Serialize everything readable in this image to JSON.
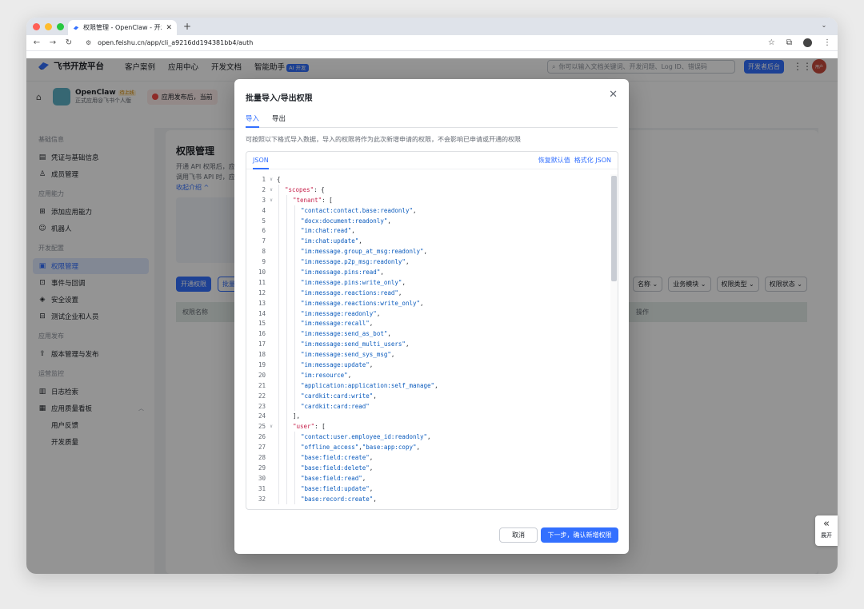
{
  "browser": {
    "tab_title": "权限管理 - OpenClaw - 开发者",
    "url": "open.feishu.cn/app/cli_a9216dd194381bb4/auth",
    "colors": {
      "close": "#ff5f57",
      "minimize": "#febc2e",
      "maximize": "#28c840"
    }
  },
  "header": {
    "brand": "飞书开放平台",
    "nav": [
      "客户案例",
      "应用中心",
      "开发文档",
      "智能助手"
    ],
    "ai_badge": "AI 开发",
    "search_placeholder": "你可以输入文档关键词、开发问题、Log ID、错误码",
    "dev_console": "开发者后台",
    "user_initials": "用户"
  },
  "app": {
    "name": "OpenClaw",
    "status": "待上线",
    "subtitle": "正式应用@飞书个人版",
    "notice": "应用发布后，当前"
  },
  "sidebar": {
    "groups": [
      {
        "title": "基础信息",
        "items": [
          {
            "icon": "doc-icon",
            "label": "凭证与基础信息"
          },
          {
            "icon": "person-icon",
            "label": "成员管理"
          }
        ]
      },
      {
        "title": "应用能力",
        "items": [
          {
            "icon": "grid-plus-icon",
            "label": "添加应用能力"
          },
          {
            "icon": "robot-icon",
            "label": "机器人"
          }
        ]
      },
      {
        "title": "开发配置",
        "items": [
          {
            "icon": "lock-icon",
            "label": "权限管理",
            "active": true
          },
          {
            "icon": "event-icon",
            "label": "事件与回调"
          },
          {
            "icon": "shield-icon",
            "label": "安全设置"
          },
          {
            "icon": "test-icon",
            "label": "测试企业和人员"
          }
        ]
      },
      {
        "title": "应用发布",
        "items": [
          {
            "icon": "upload-icon",
            "label": "版本管理与发布"
          }
        ]
      },
      {
        "title": "运营监控",
        "items": [
          {
            "icon": "log-icon",
            "label": "日志检索"
          },
          {
            "icon": "chart-icon",
            "label": "应用质量看板",
            "expanded": true
          },
          {
            "label": "用户反馈",
            "sub": true
          },
          {
            "label": "开发质量",
            "sub": true
          }
        ]
      }
    ]
  },
  "page": {
    "title": "权限管理",
    "desc_1": "开通 API 权限后，应",
    "desc_2": "调用飞书 API 时，应",
    "link": "收起介绍 ^",
    "btn_open": "开通权限",
    "btn_batch": "批量",
    "filters": [
      "名称",
      "业务模块",
      "权限类型",
      "权限状态"
    ],
    "col_name": "权限名称",
    "col_op": "操作"
  },
  "modal": {
    "title": "批量导入/导出权限",
    "tabs": [
      "导入",
      "导出"
    ],
    "description": "可按照以下格式导入数据，导入的权限将作为此次新增申请的权限，不会影响已申请或开通的权限",
    "editor_tab": "JSON",
    "restore": "恢复默认值",
    "format": "格式化 JSON",
    "cancel": "取消",
    "next": "下一步，确认新增权限",
    "code_lines": [
      {
        "n": "1",
        "fold": true,
        "indent": 0,
        "tokens": [
          [
            "pun",
            "{"
          ]
        ]
      },
      {
        "n": "2",
        "fold": true,
        "indent": 1,
        "tokens": [
          [
            "key",
            "\"scopes\""
          ],
          [
            "pun",
            ": {"
          ]
        ]
      },
      {
        "n": "3",
        "fold": true,
        "indent": 2,
        "tokens": [
          [
            "key",
            "\"tenant\""
          ],
          [
            "pun",
            ": ["
          ]
        ]
      },
      {
        "n": "4",
        "indent": 3,
        "tokens": [
          [
            "str",
            "\"contact:contact.base:readonly\""
          ],
          [
            "pun",
            ","
          ]
        ]
      },
      {
        "n": "5",
        "indent": 3,
        "tokens": [
          [
            "str",
            "\"docx:document:readonly\""
          ],
          [
            "pun",
            ","
          ]
        ]
      },
      {
        "n": "6",
        "indent": 3,
        "tokens": [
          [
            "str",
            "\"im:chat:read\""
          ],
          [
            "pun",
            ","
          ]
        ]
      },
      {
        "n": "7",
        "indent": 3,
        "tokens": [
          [
            "str",
            "\"im:chat:update\""
          ],
          [
            "pun",
            ","
          ]
        ]
      },
      {
        "n": "8",
        "indent": 3,
        "tokens": [
          [
            "str",
            "\"im:message.group_at_msg:readonly\""
          ],
          [
            "pun",
            ","
          ]
        ]
      },
      {
        "n": "9",
        "indent": 3,
        "tokens": [
          [
            "str",
            "\"im:message.p2p_msg:readonly\""
          ],
          [
            "pun",
            ","
          ]
        ]
      },
      {
        "n": "10",
        "indent": 3,
        "tokens": [
          [
            "str",
            "\"im:message.pins:read\""
          ],
          [
            "pun",
            ","
          ]
        ]
      },
      {
        "n": "11",
        "indent": 3,
        "tokens": [
          [
            "str",
            "\"im:message.pins:write_only\""
          ],
          [
            "pun",
            ","
          ]
        ]
      },
      {
        "n": "12",
        "indent": 3,
        "tokens": [
          [
            "str",
            "\"im:message.reactions:read\""
          ],
          [
            "pun",
            ","
          ]
        ]
      },
      {
        "n": "13",
        "indent": 3,
        "tokens": [
          [
            "str",
            "\"im:message.reactions:write_only\""
          ],
          [
            "pun",
            ","
          ]
        ]
      },
      {
        "n": "14",
        "indent": 3,
        "tokens": [
          [
            "str",
            "\"im:message:readonly\""
          ],
          [
            "pun",
            ","
          ]
        ]
      },
      {
        "n": "15",
        "indent": 3,
        "tokens": [
          [
            "str",
            "\"im:message:recall\""
          ],
          [
            "pun",
            ","
          ]
        ]
      },
      {
        "n": "16",
        "indent": 3,
        "tokens": [
          [
            "str",
            "\"im:message:send_as_bot\""
          ],
          [
            "pun",
            ","
          ]
        ]
      },
      {
        "n": "17",
        "indent": 3,
        "tokens": [
          [
            "str",
            "\"im:message:send_multi_users\""
          ],
          [
            "pun",
            ","
          ]
        ]
      },
      {
        "n": "18",
        "indent": 3,
        "tokens": [
          [
            "str",
            "\"im:message:send_sys_msg\""
          ],
          [
            "pun",
            ","
          ]
        ]
      },
      {
        "n": "19",
        "indent": 3,
        "tokens": [
          [
            "str",
            "\"im:message:update\""
          ],
          [
            "pun",
            ","
          ]
        ]
      },
      {
        "n": "20",
        "indent": 3,
        "tokens": [
          [
            "str",
            "\"im:resource\""
          ],
          [
            "pun",
            ","
          ]
        ]
      },
      {
        "n": "21",
        "indent": 3,
        "tokens": [
          [
            "str",
            "\"application:application:self_manage\""
          ],
          [
            "pun",
            ","
          ]
        ]
      },
      {
        "n": "22",
        "indent": 3,
        "tokens": [
          [
            "str",
            "\"cardkit:card:write\""
          ],
          [
            "pun",
            ","
          ]
        ]
      },
      {
        "n": "23",
        "indent": 3,
        "tokens": [
          [
            "str",
            "\"cardkit:card:read\""
          ]
        ]
      },
      {
        "n": "24",
        "indent": 2,
        "tokens": [
          [
            "pun",
            "],"
          ]
        ]
      },
      {
        "n": "25",
        "fold": true,
        "indent": 2,
        "tokens": [
          [
            "key",
            "\"user\""
          ],
          [
            "pun",
            ": ["
          ]
        ]
      },
      {
        "n": "26",
        "indent": 3,
        "tokens": [
          [
            "str",
            "\"contact:user.employee_id:readonly\""
          ],
          [
            "pun",
            ","
          ]
        ]
      },
      {
        "n": "27",
        "indent": 3,
        "tokens": [
          [
            "str",
            "\"offline_access\""
          ],
          [
            "pun",
            ","
          ],
          [
            "str",
            "\"base:app:copy\""
          ],
          [
            "pun",
            ","
          ]
        ]
      },
      {
        "n": "28",
        "indent": 3,
        "tokens": [
          [
            "str",
            "\"base:field:create\""
          ],
          [
            "pun",
            ","
          ]
        ]
      },
      {
        "n": "29",
        "indent": 3,
        "tokens": [
          [
            "str",
            "\"base:field:delete\""
          ],
          [
            "pun",
            ","
          ]
        ]
      },
      {
        "n": "30",
        "indent": 3,
        "tokens": [
          [
            "str",
            "\"base:field:read\""
          ],
          [
            "pun",
            ","
          ]
        ]
      },
      {
        "n": "31",
        "indent": 3,
        "tokens": [
          [
            "str",
            "\"base:field:update\""
          ],
          [
            "pun",
            ","
          ]
        ]
      },
      {
        "n": "32",
        "indent": 3,
        "tokens": [
          [
            "str",
            "\"base:record:create\""
          ],
          [
            "pun",
            ","
          ]
        ]
      }
    ]
  },
  "expand": {
    "label": "展开"
  }
}
